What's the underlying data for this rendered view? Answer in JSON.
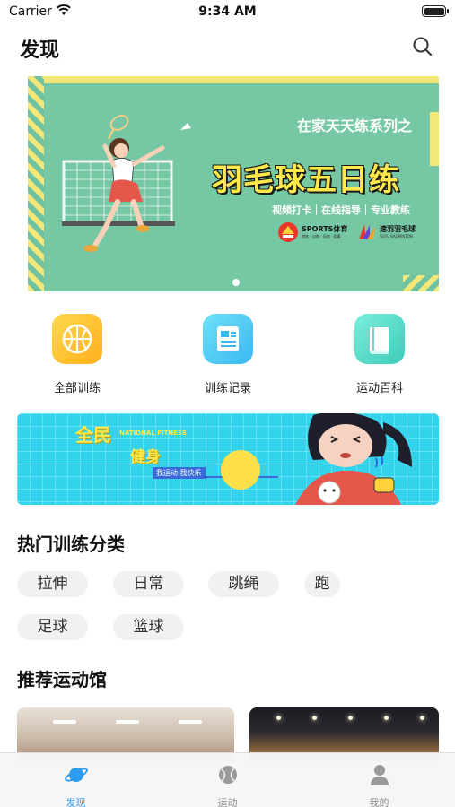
{
  "status_bar": {
    "carrier": "Carrier",
    "time": "9:34 AM"
  },
  "header": {
    "title": "发现",
    "search_icon": "search-icon"
  },
  "banner": {
    "series": "在家天天练系列之",
    "headline": "羽毛球五日练",
    "tagline": "视频打卡｜在线指导｜专业教练",
    "logo1": {
      "name": "SPORTS体育",
      "sub": "教练 · 训练 · 场地 · 赛事"
    },
    "logo2": {
      "name": "速羽羽毛球",
      "sub": "SUYU BADMINTON"
    },
    "colors": {
      "background": "#76c8a4",
      "headline": "#ffe94a",
      "accent": "#f3e77a"
    }
  },
  "quick_entries": [
    {
      "label": "全部训练",
      "icon": "basketball-icon"
    },
    {
      "label": "训练记录",
      "icon": "record-icon"
    },
    {
      "label": "运动百科",
      "icon": "book-icon"
    }
  ],
  "promo": {
    "title": "全民",
    "title_en": "NATIONAL FITNESS",
    "subtitle": "健身",
    "slogan": "我运动 我快乐"
  },
  "hot_categories": {
    "title": "热门训练分类",
    "items": [
      "拉伸",
      "日常",
      "跳绳",
      "跑",
      "足球",
      "篮球"
    ]
  },
  "venues": {
    "title": "推荐运动馆"
  },
  "tabbar": {
    "items": [
      {
        "label": "发现",
        "icon": "planet-icon",
        "active": true
      },
      {
        "label": "运动",
        "icon": "ball-icon",
        "active": false
      },
      {
        "label": "我的",
        "icon": "person-icon",
        "active": false
      }
    ],
    "active_color": "#2d9cf0"
  }
}
